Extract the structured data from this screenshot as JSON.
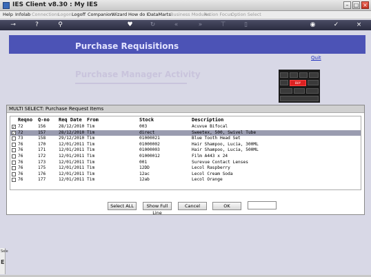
{
  "window": {
    "title": "IES Client v8.30 : My IES"
  },
  "menu": [
    "Help",
    "Infolab",
    "Connections",
    "Logon",
    "Logoff",
    "Companion",
    "Wizard",
    "How do I",
    "DataMarts",
    "Business Modules",
    "Action Focus",
    "Option Select"
  ],
  "menu_disabled": [
    "Connections",
    "Logon",
    "Business Modules",
    "Action Focus",
    "Option Select"
  ],
  "banner": {
    "title": "Purchase Requisitions"
  },
  "quit_link": "Quit",
  "subheading": "Purchase Manager Activity",
  "keyboard_key_label": "BUY",
  "dialog": {
    "title": "MULTI SELECT: Purchase Request Items",
    "columns": [
      "Reqno",
      "Q-no",
      "Req Date",
      "From",
      "Stock",
      "Description"
    ],
    "rows": [
      {
        "checked": true,
        "selected": false,
        "reqno": "72",
        "qno": "156",
        "date": "28/12/2010",
        "from": "Tim",
        "stock": "003",
        "desc": "Acuvue Bifocal"
      },
      {
        "checked": true,
        "selected": true,
        "reqno": "72",
        "qno": "157",
        "date": "28/12/2010",
        "from": "Tim",
        "stock": "direct",
        "desc": "Sweetex, 500, Swivel Tube"
      },
      {
        "checked": false,
        "selected": false,
        "reqno": "73",
        "qno": "158",
        "date": "29/12/2010",
        "from": "Tim",
        "stock": "01000021",
        "desc": "Blue Tooth Head Set"
      },
      {
        "checked": false,
        "selected": false,
        "reqno": "76",
        "qno": "170",
        "date": "12/01/2011",
        "from": "Tim",
        "stock": "01000002",
        "desc": "Hair Shampoo, Lucia, 300ML"
      },
      {
        "checked": false,
        "selected": false,
        "reqno": "76",
        "qno": "171",
        "date": "12/01/2011",
        "from": "Tim",
        "stock": "01000003",
        "desc": "Hair Shampoo, Lucia, 500ML"
      },
      {
        "checked": false,
        "selected": false,
        "reqno": "76",
        "qno": "172",
        "date": "12/01/2011",
        "from": "Tim",
        "stock": "01000012",
        "desc": "Film A443 x 24"
      },
      {
        "checked": false,
        "selected": false,
        "reqno": "76",
        "qno": "173",
        "date": "12/01/2011",
        "from": "Tim",
        "stock": "001",
        "desc": "Surevue Contact Lenses"
      },
      {
        "checked": false,
        "selected": false,
        "reqno": "76",
        "qno": "175",
        "date": "12/01/2011",
        "from": "Tim",
        "stock": "12DD",
        "desc": "Lecol Raspberry"
      },
      {
        "checked": false,
        "selected": false,
        "reqno": "76",
        "qno": "176",
        "date": "12/01/2011",
        "from": "Tim",
        "stock": "12ac",
        "desc": "Lecol Cream Soda"
      },
      {
        "checked": false,
        "selected": false,
        "reqno": "76",
        "qno": "177",
        "date": "12/01/2011",
        "from": "Tim",
        "stock": "12ab",
        "desc": "Lecol Orange"
      }
    ],
    "buttons": {
      "select_all": "Select ALL",
      "show_full_line": "Show Full Line",
      "cancel": "Cancel",
      "ok": "OK"
    },
    "input_value": ""
  },
  "side_labels": [
    "Sele",
    "E"
  ],
  "toolbar_icons": [
    "key-icon",
    "help-icon",
    "search-icon",
    "heart-icon",
    "refresh-icon",
    "rewind-icon",
    "fast-forward-icon",
    "filter-icon",
    "document-icon",
    "globe-icon",
    "check-icon",
    "close-icon"
  ],
  "colors": {
    "banner": "#4c53b6",
    "selected_row": "#9a9cb0",
    "toolbar": "#2a2c40"
  }
}
